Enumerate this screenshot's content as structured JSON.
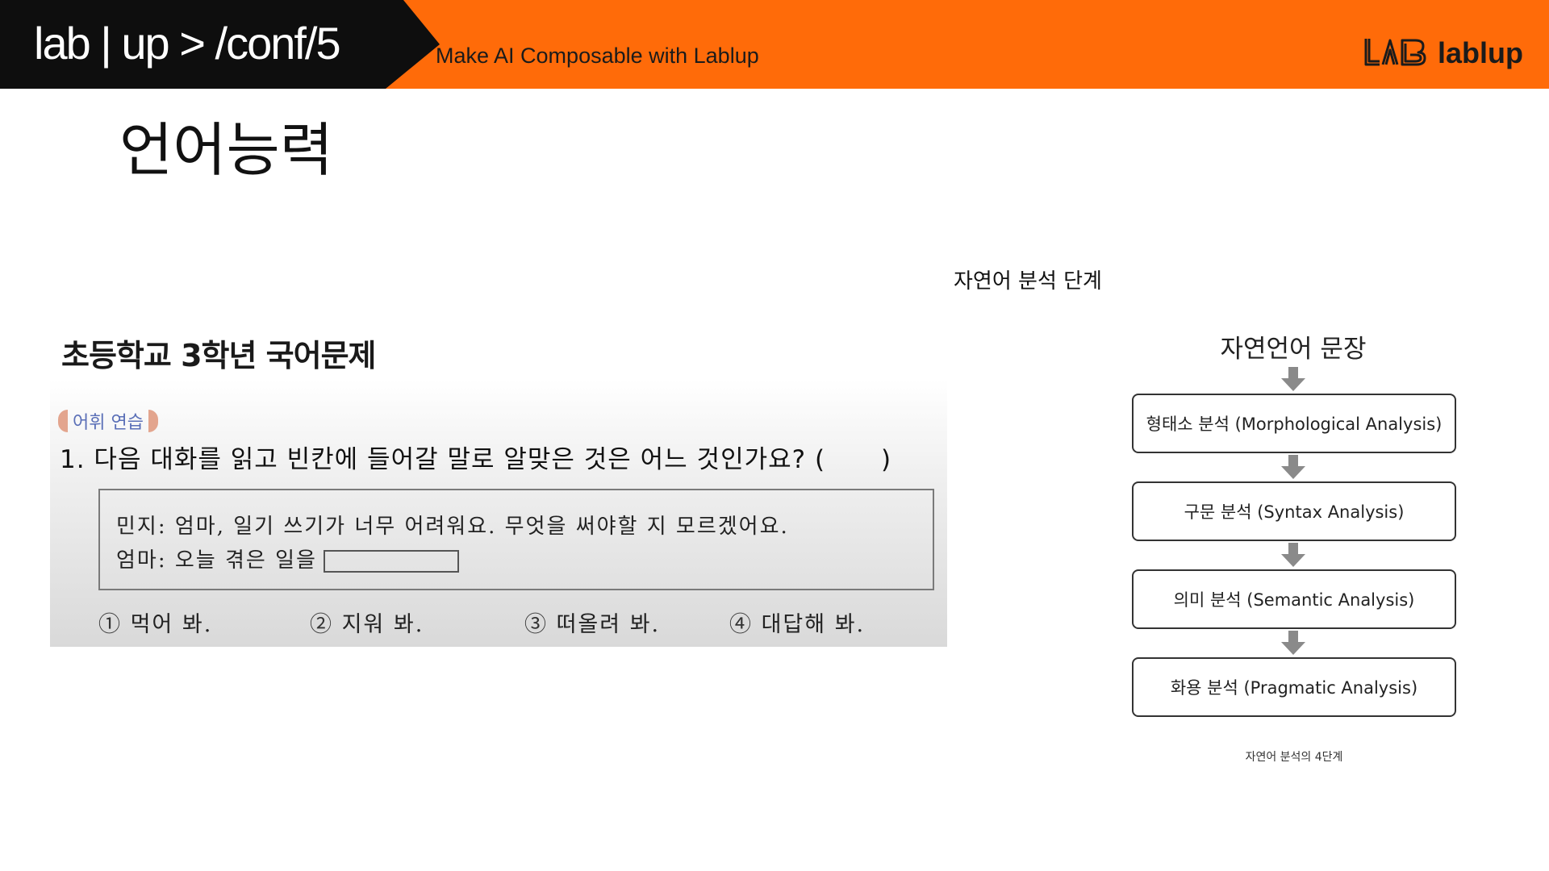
{
  "header": {
    "conf_title": "lab | up > /conf/5",
    "tagline": "Make AI Composable with Lablup",
    "brand_name": "lablup",
    "brand_logo_icon": "lablup-logo-icon",
    "colors": {
      "accent": "#ff6b09",
      "dark": "#0e0e0e"
    }
  },
  "slide": {
    "title": "언어능력"
  },
  "exam": {
    "heading": "초등학교 3학년 국어문제",
    "badge": "어휘 연습",
    "question": "1. 다음 대화를 읽고 빈칸에 들어갈 말로 알맞은 것은 어느 것인가요? (",
    "question_close": ")",
    "dialog": {
      "line1": "민지: 엄마, 일기 쓰기가 너무 어려워요. 무엇을 써야할 지 모르겠어요.",
      "line2": "엄마: 오늘 겪은 일을"
    },
    "choices": [
      {
        "num": "①",
        "text": "먹어 봐."
      },
      {
        "num": "②",
        "text": "지워 봐."
      },
      {
        "num": "③",
        "text": "떠올려 봐."
      },
      {
        "num": "④",
        "text": "대답해 봐."
      }
    ]
  },
  "nlp": {
    "caption": "자연어 분석 단계",
    "flow_title": "자연언어 문장",
    "stages": [
      {
        "label": "형태소 분석 (Morphological Analysis)"
      },
      {
        "label": "구문 분석 (Syntax Analysis)"
      },
      {
        "label": "의미 분석 (Semantic Analysis)"
      },
      {
        "label": "화용 분석 (Pragmatic Analysis)"
      }
    ],
    "footnote": "자연어 분석의 4단계",
    "arrow_icon": "down-arrow-icon"
  }
}
